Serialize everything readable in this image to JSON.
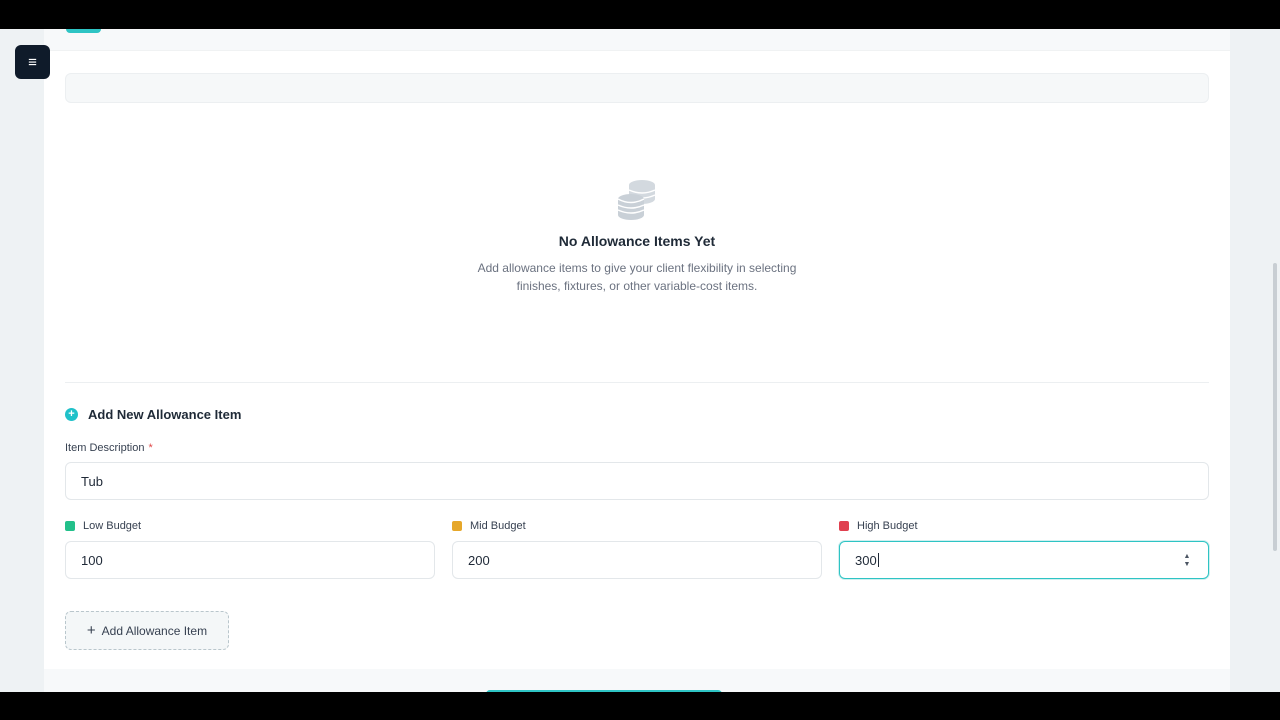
{
  "menu": {
    "icon": "hamburger-menu-icon",
    "glyph": "≡"
  },
  "empty_state": {
    "icon": "coins-stack-icon",
    "title": "No Allowance Items Yet",
    "description_line1": "Add allowance items to give your client flexibility in selecting",
    "description_line2": "finishes, fixtures, or other variable-cost items."
  },
  "add_section": {
    "icon": "plus-circle-icon",
    "title": "Add New Allowance Item",
    "description_label": "Item Description",
    "required_marker": "*",
    "description_value": "Tub",
    "low_label": "Low Budget",
    "low_value": "100",
    "low_color": "#22c08a",
    "mid_label": "Mid Budget",
    "mid_value": "200",
    "mid_color": "#e6a72a",
    "high_label": "High Budget",
    "high_value": "300",
    "high_color": "#e0404f",
    "add_button_label": "Add Allowance Item",
    "add_button_icon": "plus-icon"
  },
  "colors": {
    "accent": "#2ec4c4"
  }
}
